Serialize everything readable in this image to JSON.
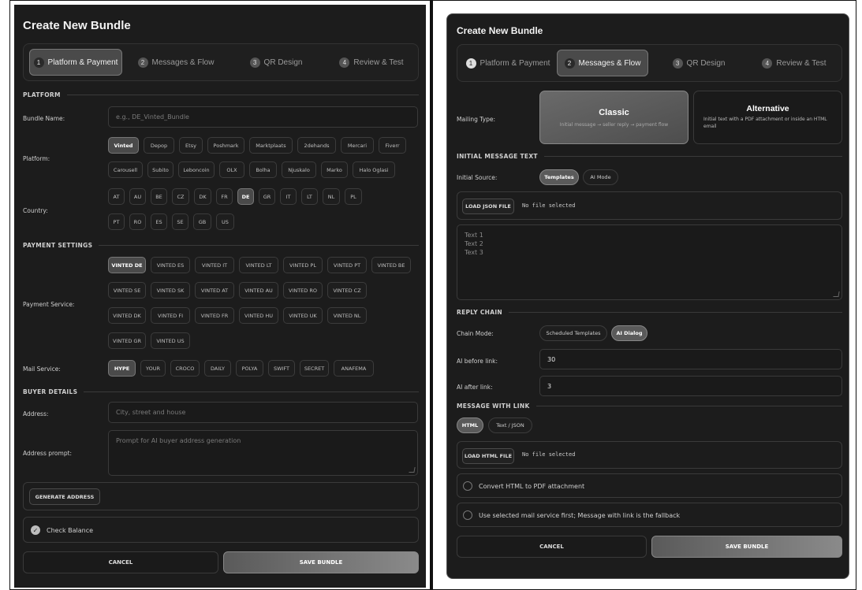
{
  "left": {
    "title": "Create New Bundle",
    "steps": [
      {
        "num": "1",
        "label": "Platform & Payment"
      },
      {
        "num": "2",
        "label": "Messages & Flow"
      },
      {
        "num": "3",
        "label": "QR Design"
      },
      {
        "num": "4",
        "label": "Review & Test"
      }
    ],
    "platform_section": "PLATFORM",
    "bundle_name": {
      "label": "Bundle Name:",
      "placeholder": "e.g., DE_Vinted_Bundle"
    },
    "platform": {
      "label": "Platform:",
      "selected": "Vinted",
      "options": [
        "Vinted",
        "Depop",
        "Etsy",
        "Poshmark",
        "Marktplaats",
        "2dehands",
        "Mercari",
        "Fiverr",
        "Carousell",
        "Subito",
        "Leboncoin",
        "OLX",
        "Bolha",
        "Njuskalo",
        "Marko",
        "Halo Oglasi"
      ]
    },
    "country": {
      "label": "Country:",
      "selected": "DE",
      "options": [
        "AT",
        "AU",
        "BE",
        "CZ",
        "DK",
        "FR",
        "DE",
        "GR",
        "IT",
        "LT",
        "NL",
        "PL",
        "PT",
        "RO",
        "ES",
        "SE",
        "GB",
        "US"
      ]
    },
    "payment_section": "PAYMENT SETTINGS",
    "payment_service": {
      "label": "Payment Service:",
      "selected": "VINTED DE",
      "options": [
        "VINTED DE",
        "VINTED ES",
        "VINTED IT",
        "VINTED LT",
        "VINTED PL",
        "VINTED PT",
        "VINTED BE",
        "VINTED SE",
        "VINTED SK",
        "VINTED AT",
        "VINTED AU",
        "VINTED RO",
        "VINTED CZ",
        "VINTED DK",
        "VINTED FI",
        "VINTED FR",
        "VINTED HU",
        "VINTED UK",
        "VINTED NL",
        "VINTED GR",
        "VINTED US"
      ]
    },
    "mail_service": {
      "label": "Mail Service:",
      "selected": "HYPE",
      "options": [
        "HYPE",
        "YOUR",
        "CROCO",
        "DAILY",
        "POLYA",
        "SWIFT",
        "SECRET",
        "ANAFEMA"
      ]
    },
    "buyer_section": "BUYER DETAILS",
    "address": {
      "label": "Address:",
      "placeholder": "City, street and house"
    },
    "address_prompt": {
      "label": "Address prompt:",
      "placeholder": "Prompt for AI buyer address generation"
    },
    "generate_address": "GENERATE ADDRESS",
    "check_balance": "Check Balance",
    "cancel": "CANCEL",
    "save": "SAVE BUNDLE"
  },
  "right": {
    "title": "Create New Bundle",
    "steps": [
      {
        "num": "1",
        "label": "Platform & Payment"
      },
      {
        "num": "2",
        "label": "Messages & Flow"
      },
      {
        "num": "3",
        "label": "QR Design"
      },
      {
        "num": "4",
        "label": "Review & Test"
      }
    ],
    "mailing_type": {
      "label": "Mailing Type:",
      "classic": {
        "title": "Classic",
        "desc": "Initial message → seller reply → payment flow"
      },
      "alternative": {
        "title": "Alternative",
        "desc": "Initial text with a PDF attachment or inside an HTML email"
      }
    },
    "initial_section": "INITIAL MESSAGE TEXT",
    "initial_source": {
      "label": "Initial Source:",
      "options": [
        "Templates",
        "AI Mode"
      ],
      "selected": "Templates"
    },
    "load_json": "LOAD JSON FILE",
    "json_status": "No file selected",
    "textarea_lines": [
      "Text 1",
      "Text 2",
      "Text 3"
    ],
    "reply_section": "REPLY CHAIN",
    "chain_mode": {
      "label": "Chain Mode:",
      "options": [
        "Scheduled Templates",
        "AI Dialog"
      ],
      "selected": "AI Dialog"
    },
    "ai_before": {
      "label": "AI before link:",
      "value": "30"
    },
    "ai_after": {
      "label": "AI after link:",
      "value": "3"
    },
    "link_section": "MESSAGE WITH LINK",
    "link_format": {
      "options": [
        "HTML",
        "Text / JSON"
      ],
      "selected": "HTML"
    },
    "load_html": "LOAD HTML FILE",
    "html_status": "No file selected",
    "convert_pdf": "Convert HTML to PDF attachment",
    "use_mail_first": "Use selected mail service first; Message with link is the fallback",
    "cancel": "CANCEL",
    "save": "SAVE BUNDLE"
  }
}
